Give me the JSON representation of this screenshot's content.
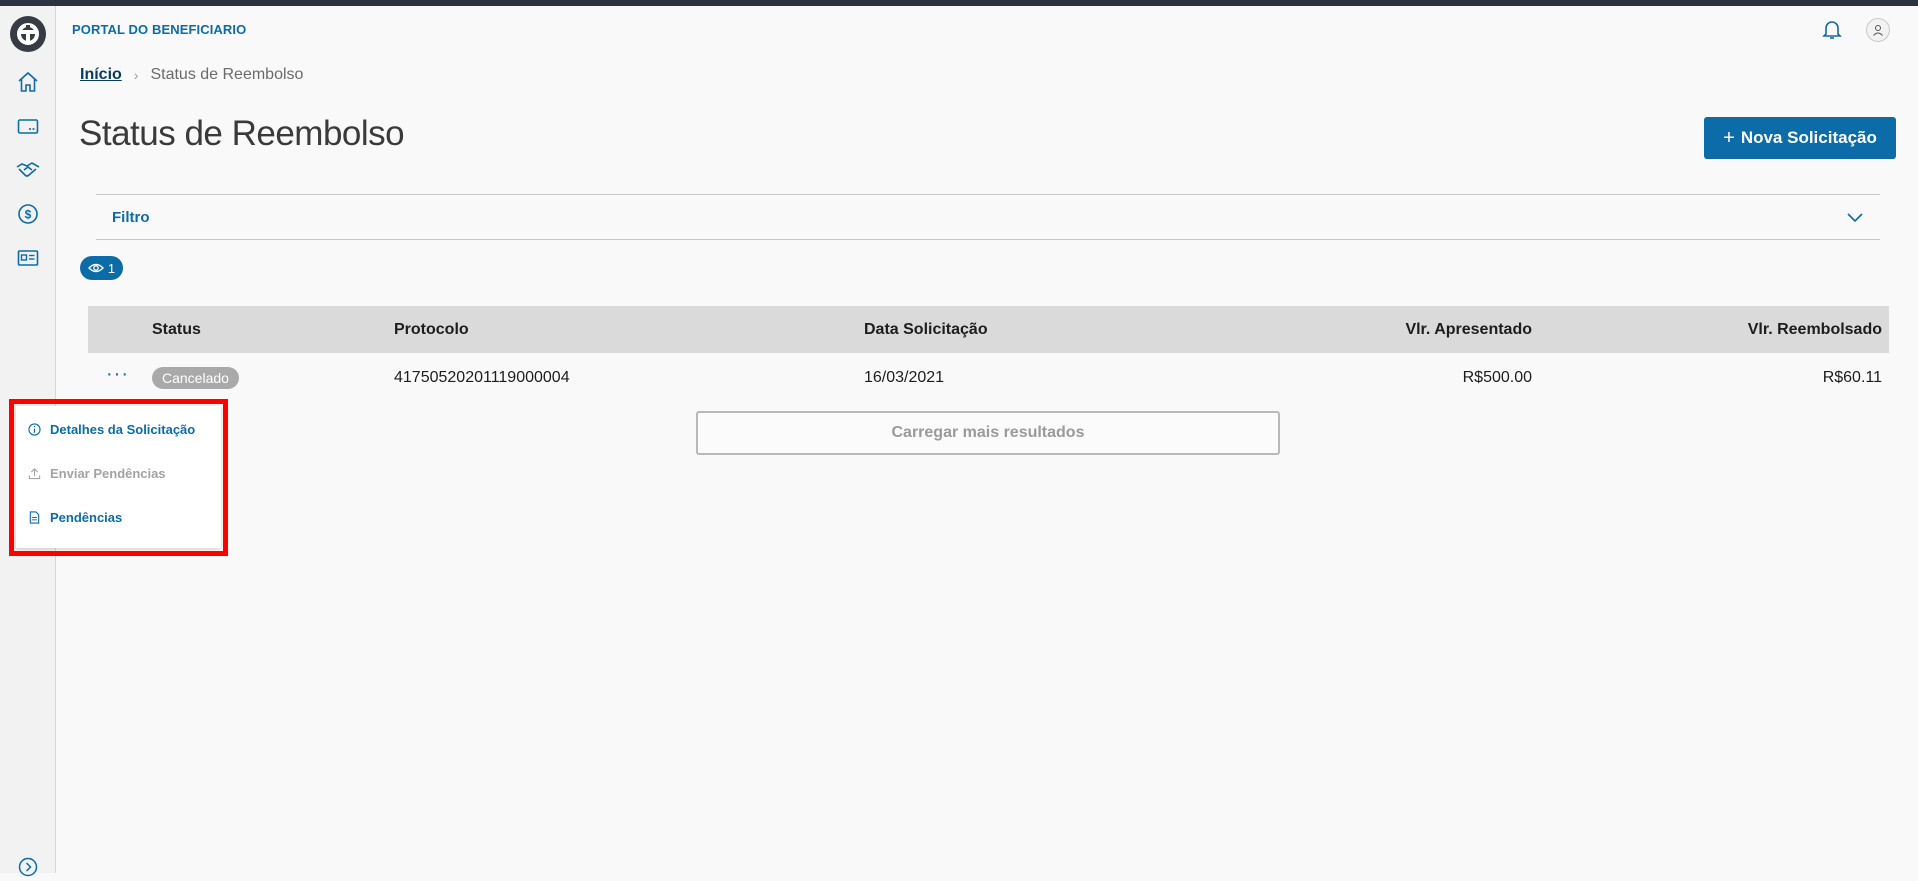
{
  "header": {
    "title": "PORTAL DO BENEFICIARIO"
  },
  "sidebar": {
    "items": [
      {
        "icon": "home-icon"
      },
      {
        "icon": "card-icon"
      },
      {
        "icon": "handshake-icon"
      },
      {
        "icon": "dollar-icon"
      },
      {
        "icon": "id-card-icon"
      }
    ],
    "expand_icon": "chevron-right-circle-icon"
  },
  "breadcrumb": {
    "home": "Início",
    "current": "Status de Reembolso"
  },
  "page": {
    "title": "Status de Reembolso",
    "new_button": "Nova Solicitação",
    "filter_label": "Filtro",
    "view_count": "1",
    "load_more": "Carregar mais resultados"
  },
  "table": {
    "columns": [
      "Status",
      "Protocolo",
      "Data Solicitação",
      "Vlr. Apresentado",
      "Vlr. Reembolsado"
    ],
    "rows": [
      {
        "status": "Cancelado",
        "protocolo": "41750520201119000004",
        "data": "16/03/2021",
        "apresentado": "R$500.00",
        "reembolsado": "R$60.11"
      }
    ]
  },
  "row_menu": {
    "items": [
      {
        "label": "Detalhes da Solicitação",
        "icon": "info-icon",
        "disabled": false
      },
      {
        "label": "Enviar Pendências",
        "icon": "upload-icon",
        "disabled": true
      },
      {
        "label": "Pendências",
        "icon": "document-icon",
        "disabled": false
      }
    ]
  },
  "colors": {
    "primary": "#0c6ca8",
    "highlight": "#ff0000",
    "status_badge": "#a9a9a9"
  }
}
